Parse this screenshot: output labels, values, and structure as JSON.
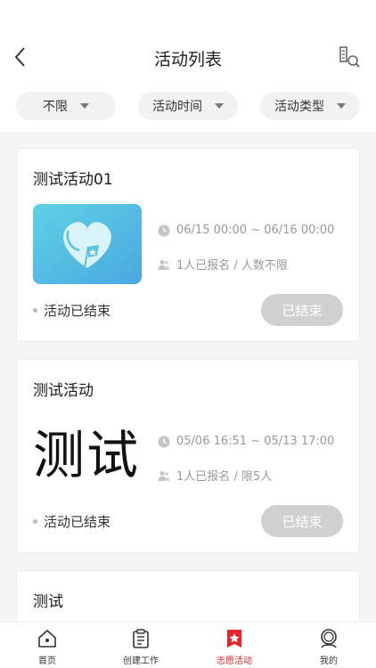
{
  "header": {
    "title": "活动列表"
  },
  "filters": [
    {
      "label": "不限"
    },
    {
      "label": "活动时间"
    },
    {
      "label": "活动类型"
    }
  ],
  "activities": [
    {
      "title": "测试活动01",
      "time": "06/15 00:00 ~ 06/16 00:00",
      "signup": "1人已报名 / 人数不限",
      "status": "活动已结束",
      "button": "已结束"
    },
    {
      "title": "测试活动",
      "thumb_text": "测试",
      "time": "05/06 16:51 ~ 05/13 17:00",
      "signup": "1人已报名 / 限5人",
      "status": "活动已结束",
      "button": "已结束"
    },
    {
      "title": "测试"
    }
  ],
  "tabbar": [
    {
      "label": "首页",
      "icon": "home-icon"
    },
    {
      "label": "创建工作",
      "icon": "clipboard-icon"
    },
    {
      "label": "志愿活动",
      "icon": "volunteer-star-icon",
      "active": true
    },
    {
      "label": "我的",
      "icon": "profile-icon"
    }
  ],
  "colors": {
    "accent": "#e5242b",
    "disabled_button": "#d0d0d0"
  }
}
